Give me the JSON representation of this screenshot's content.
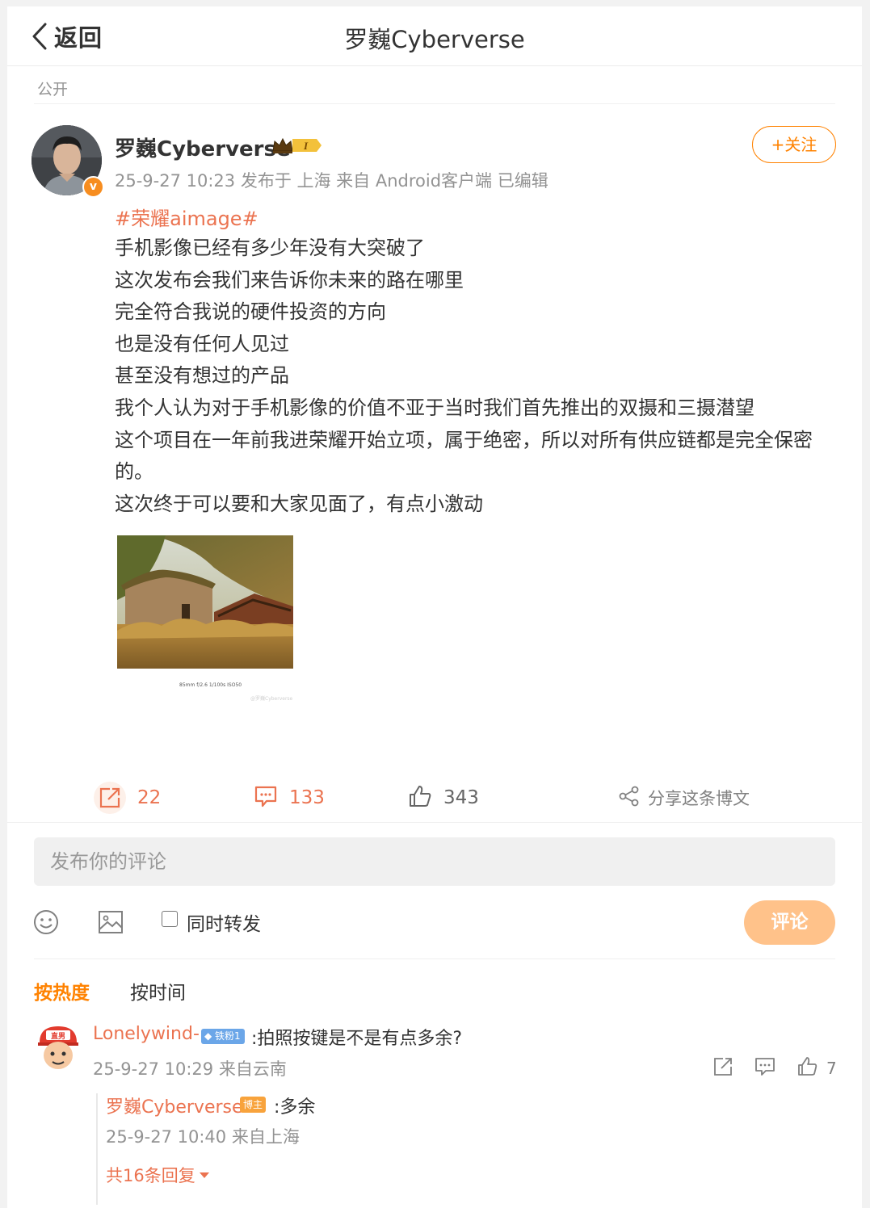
{
  "header": {
    "back_label": "返回",
    "title": "罗巍Cyberverse"
  },
  "post": {
    "visibility": "公开",
    "author": "罗巍Cyberverse",
    "member_level": "I",
    "verified_mark": "v",
    "meta": "25-9-27 10:23 发布于 上海 来自 Android客户端 已编辑",
    "follow_label": "+关注",
    "topic": "#荣耀aimage#",
    "lines": [
      "手机影像已经有多少年没有大突破了",
      "这次发布会我们来告诉你未来的路在哪里",
      "完全符合我说的硬件投资的方向",
      "也是没有任何人见过",
      "甚至没有想过的产品",
      "我个人认为对于手机影像的价值不亚于当时我们首先推出的双摄和三摄潜望",
      "这个项目在一年前我进荣耀开始立项，属于绝密，所以对所有供应链都是完全保密",
      "的。",
      "这次终于可以要和大家见面了，有点小激动"
    ],
    "photo_exif": "85mm  f/2.6  1/100s  ISO50",
    "photo_watermark": "@罗巍Cyberverse"
  },
  "actions": {
    "repost_count": "22",
    "comment_count": "133",
    "like_count": "343",
    "share_label": "分享这条博文"
  },
  "composer": {
    "placeholder": "发布你的评论",
    "repost_label": "同时转发",
    "submit_label": "评论"
  },
  "sort": {
    "hot_label": "按热度",
    "time_label": "按时间"
  },
  "comment": {
    "avatar_text": "直男",
    "user": "Lonelywind-",
    "fan_badge": "铁粉1",
    "text": ":拍照按键是不是有点多余?",
    "meta": "25-9-27 10:29 来自云南",
    "like_count": "7"
  },
  "reply": {
    "user": "罗巍Cyberverse",
    "badge": "博主",
    "text": ":多余",
    "meta": "25-9-27 10:40 来自上海",
    "more_label": "共16条回复"
  },
  "colors": {
    "accent": "#ff8200",
    "link": "#eb7350",
    "meta": "#939393",
    "submit_disabled": "#ffc28a"
  },
  "icons": [
    "chevron-left-icon",
    "crown-icon",
    "repost-icon",
    "comment-icon",
    "like-icon",
    "share-icon",
    "emoji-icon",
    "image-icon",
    "caret-down-icon"
  ]
}
